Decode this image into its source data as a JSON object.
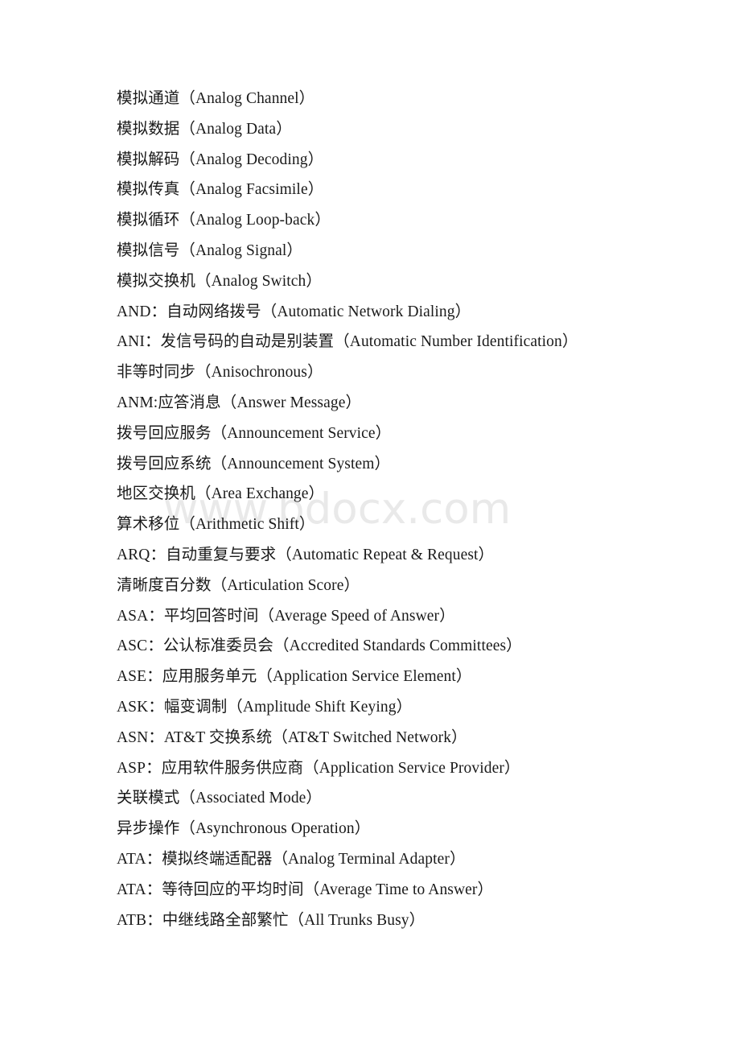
{
  "document": {
    "watermark": "www.bdocx.com",
    "watermark_color": "#e9e9e9",
    "text_color": "#1a1a1a",
    "background_color": "#ffffff",
    "entries": [
      {
        "text": "模拟通道（Analog Channel）"
      },
      {
        "text": "模拟数据（Analog Data）"
      },
      {
        "text": "模拟解码（Analog Decoding）"
      },
      {
        "text": "模拟传真（Analog Facsimile）"
      },
      {
        "text": "模拟循环（Analog Loop-back）"
      },
      {
        "text": "模拟信号（Analog Signal）"
      },
      {
        "text": "模拟交换机（Analog Switch）"
      },
      {
        "text": "AND：自动网络拨号（Automatic Network Dialing）"
      },
      {
        "text": "ANI：发信号码的自动是别装置（Automatic Number Identification）"
      },
      {
        "text": "非等时同步（Anisochronous）"
      },
      {
        "text": "ANM:应答消息（Answer Message）"
      },
      {
        "text": "拨号回应服务（Announcement Service）"
      },
      {
        "text": "拨号回应系统（Announcement System）"
      },
      {
        "text": "地区交换机（Area Exchange）"
      },
      {
        "text": "算术移位（Arithmetic Shift）"
      },
      {
        "text": "ARQ：自动重复与要求（Automatic Repeat & Request）"
      },
      {
        "text": "清晰度百分数（Articulation Score）"
      },
      {
        "text": "ASA：平均回答时间（Average Speed of Answer）"
      },
      {
        "text": "ASC：公认标准委员会（Accredited Standards Committees）"
      },
      {
        "text": "ASE：应用服务单元（Application Service Element）"
      },
      {
        "text": "ASK：幅变调制（Amplitude Shift Keying）"
      },
      {
        "text": "ASN：AT&T 交换系统（AT&T Switched Network）"
      },
      {
        "text": "ASP：应用软件服务供应商（Application Service Provider）"
      },
      {
        "text": "关联模式（Associated Mode）"
      },
      {
        "text": "异步操作（Asynchronous Operation）"
      },
      {
        "text": "ATA：模拟终端适配器（Analog Terminal Adapter）"
      },
      {
        "text": "ATA：等待回应的平均时间（Average Time to Answer）"
      },
      {
        "text": "ATB：中继线路全部繁忙（All Trunks Busy）"
      }
    ]
  }
}
